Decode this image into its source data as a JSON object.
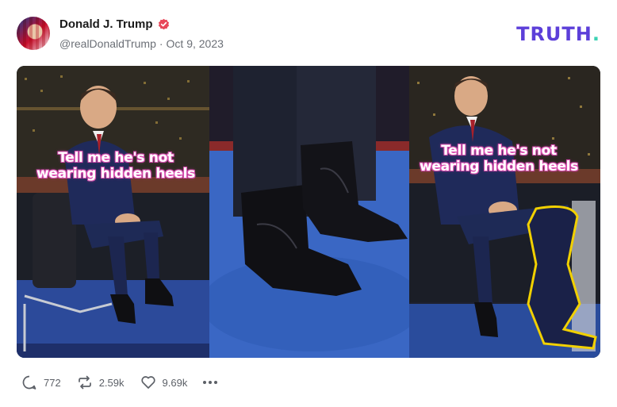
{
  "post": {
    "author_name": "Donald J. Trump",
    "handle": "@realDonaldTrump",
    "separator": "·",
    "date": "Oct 9, 2023"
  },
  "brand": {
    "logo_text": "TRUTH",
    "logo_dot": ".",
    "primary_color": "#5c3fd9",
    "accent_color": "#3bd2b3"
  },
  "media": {
    "caption_left": "Tell me he's not wearing hidden heels",
    "caption_right": "Tell me he's not wearing hidden heels"
  },
  "actions": {
    "replies": "772",
    "retruths": "2.59k",
    "likes": "9.69k"
  },
  "icons": [
    "verified-badge-icon",
    "reply-icon",
    "retruth-icon",
    "like-icon",
    "more-icon"
  ]
}
